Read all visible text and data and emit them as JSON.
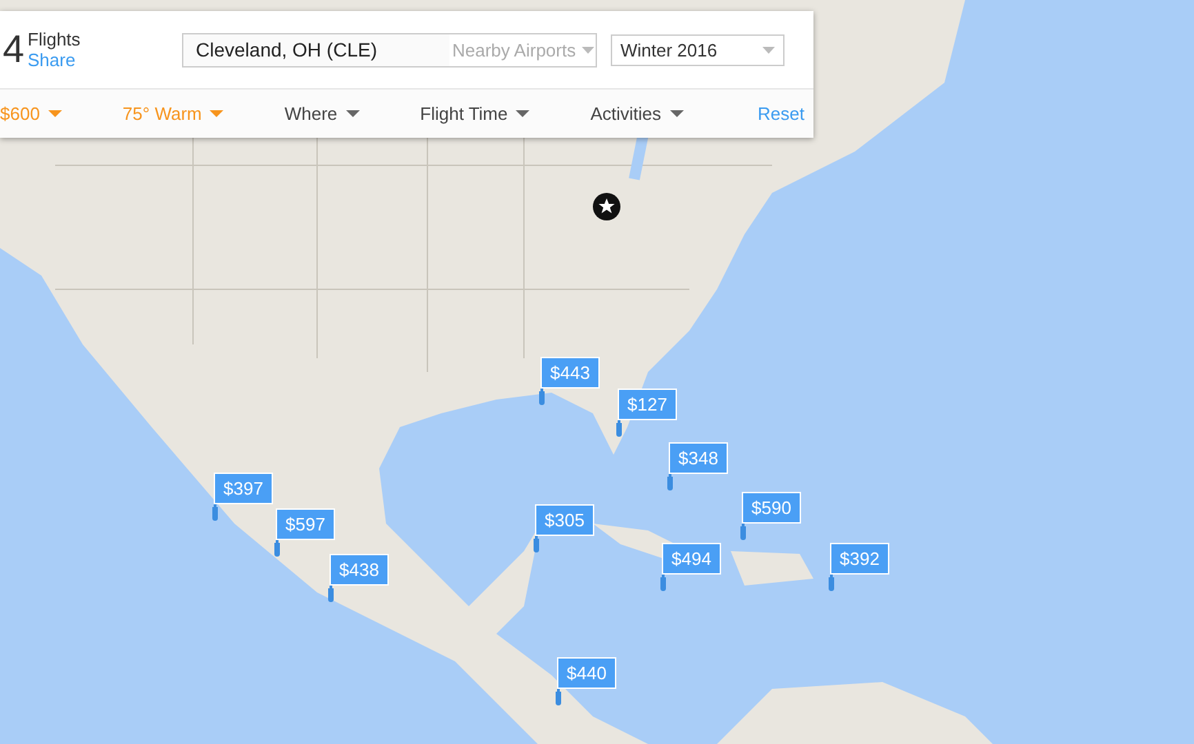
{
  "panel": {
    "count": "4",
    "count_label": "Flights",
    "share_link": "Share",
    "origin": {
      "value": "Cleveland, OH (CLE)",
      "nearby": "Nearby Airports"
    },
    "season": {
      "value": "Winter 2016"
    },
    "filters": [
      {
        "label": "$600",
        "active": true
      },
      {
        "label": "75° Warm",
        "active": true
      },
      {
        "label": "Where",
        "active": false
      },
      {
        "label": "Flight Time",
        "active": false
      },
      {
        "label": "Activities",
        "active": false
      }
    ],
    "reset": "Reset"
  },
  "map": {
    "pins": [
      {
        "price": "$443"
      },
      {
        "price": "$127"
      },
      {
        "price": "$348"
      },
      {
        "price": "$397"
      },
      {
        "price": "$597"
      },
      {
        "price": "$305"
      },
      {
        "price": "$590"
      },
      {
        "price": "$494"
      },
      {
        "price": "$392"
      },
      {
        "price": "$438"
      },
      {
        "price": "$440"
      }
    ]
  }
}
